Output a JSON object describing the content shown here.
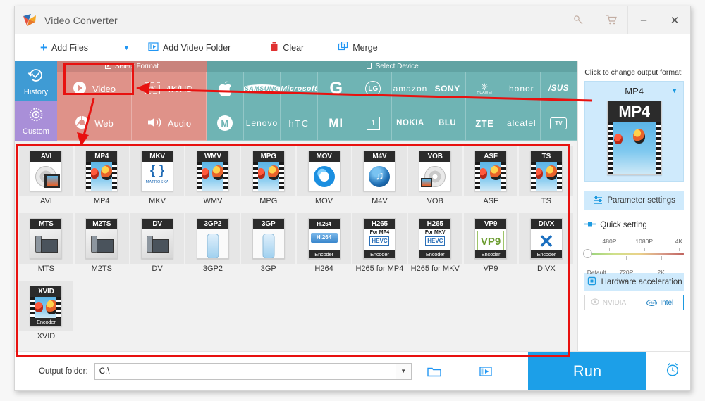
{
  "window": {
    "title": "Video Converter",
    "logo_icon": "app-logo-icon",
    "key_icon": "key-icon",
    "cart_icon": "cart-icon",
    "minimize": "–",
    "close": "✕"
  },
  "toolbar": {
    "add_files": "Add Files",
    "add_files_caret": "▼",
    "add_video_folder": "Add Video Folder",
    "clear": "Clear",
    "merge": "Merge",
    "plus_icon": "plus-icon",
    "folder_icon": "add-video-folder-icon",
    "trash_icon": "trash-icon",
    "merge_icon": "merge-icon"
  },
  "sidebar": {
    "items": [
      {
        "label": "History",
        "icon": "history-icon",
        "color": "#3f9bd4"
      },
      {
        "label": "Custom",
        "icon": "gear-icon",
        "color": "#a98fd8"
      }
    ]
  },
  "select_format": {
    "header": "Select Format",
    "header_icon": "format-icon",
    "tiles": [
      {
        "label": "Video",
        "icon": "play-circle-icon",
        "selected": true
      },
      {
        "label": "4K/HD",
        "icon": "hd-icon",
        "selected": false
      },
      {
        "label": "Web",
        "icon": "chrome-icon",
        "selected": false
      },
      {
        "label": "Audio",
        "icon": "speaker-icon",
        "selected": false
      }
    ]
  },
  "select_device": {
    "header": "Select Device",
    "header_icon": "device-icon",
    "tiles": [
      {
        "label": "Apple",
        "glyph": "",
        "style": "glyph"
      },
      {
        "label": "SAMSUNG",
        "glyph": "SAMSUNG",
        "style": "wordmark"
      },
      {
        "label": "Microsoft",
        "glyph": "Microsoft",
        "style": "wordmark"
      },
      {
        "label": "Google",
        "glyph": "G",
        "style": "big"
      },
      {
        "label": "LG",
        "glyph": "LG",
        "style": "round"
      },
      {
        "label": "amazon",
        "glyph": "amazon",
        "style": "thin"
      },
      {
        "label": "SONY",
        "glyph": "SONY",
        "style": "wordmark"
      },
      {
        "label": "HUAWEI",
        "glyph": "HUAWEI",
        "style": "huawei"
      },
      {
        "label": "honor",
        "glyph": "honor",
        "style": "thin"
      },
      {
        "label": "ASUS",
        "glyph": "/SUS",
        "style": "wordmark"
      },
      {
        "label": "Motorola",
        "glyph": "M",
        "style": "round"
      },
      {
        "label": "Lenovo",
        "glyph": "Lenovo",
        "style": "thin"
      },
      {
        "label": "HTC",
        "glyph": "hTC",
        "style": "thin"
      },
      {
        "label": "MI",
        "glyph": "MI",
        "style": "wordmark"
      },
      {
        "label": "OnePlus",
        "glyph": "1",
        "style": "boxed"
      },
      {
        "label": "NOKIA",
        "glyph": "NOKIA",
        "style": "wordmark"
      },
      {
        "label": "BLU",
        "glyph": "BLU",
        "style": "wordmark"
      },
      {
        "label": "ZTE",
        "glyph": "ZTE",
        "style": "wordmark"
      },
      {
        "label": "alcatel",
        "glyph": "alcatel",
        "style": "thin"
      },
      {
        "label": "TV",
        "glyph": "TV",
        "style": "tv"
      }
    ]
  },
  "formats": [
    {
      "label": "AVI",
      "badge": "AVI",
      "sub": "",
      "bottom": "",
      "art": "disc-film"
    },
    {
      "label": "MP4",
      "badge": "MP4",
      "sub": "",
      "bottom": "",
      "art": "balloon"
    },
    {
      "label": "MKV",
      "badge": "MKV",
      "sub": "",
      "bottom": "",
      "art": "matroska"
    },
    {
      "label": "WMV",
      "badge": "WMV",
      "sub": "",
      "bottom": "",
      "art": "balloon"
    },
    {
      "label": "MPG",
      "badge": "MPG",
      "sub": "",
      "bottom": "",
      "art": "balloon"
    },
    {
      "label": "MOV",
      "badge": "MOV",
      "sub": "",
      "bottom": "",
      "art": "quicktime"
    },
    {
      "label": "M4V",
      "badge": "M4V",
      "sub": "",
      "bottom": "",
      "art": "itunes"
    },
    {
      "label": "VOB",
      "badge": "VOB",
      "sub": "",
      "bottom": "",
      "art": "disc"
    },
    {
      "label": "ASF",
      "badge": "ASF",
      "sub": "",
      "bottom": "",
      "art": "balloon"
    },
    {
      "label": "TS",
      "badge": "TS",
      "sub": "",
      "bottom": "",
      "art": "balloon"
    },
    {
      "label": "MTS",
      "badge": "MTS",
      "sub": "",
      "bottom": "",
      "art": "camcorder"
    },
    {
      "label": "M2TS",
      "badge": "M2TS",
      "sub": "",
      "bottom": "",
      "art": "camcorder"
    },
    {
      "label": "DV",
      "badge": "DV",
      "sub": "",
      "bottom": "",
      "art": "camcorder"
    },
    {
      "label": "3GP2",
      "badge": "3GP2",
      "sub": "",
      "bottom": "",
      "art": "phone"
    },
    {
      "label": "3GP",
      "badge": "3GP",
      "sub": "",
      "bottom": "",
      "art": "phone"
    },
    {
      "label": "H264",
      "badge": "H.264",
      "sub": "",
      "bottom": "Encoder",
      "art": "h264"
    },
    {
      "label": "H265 for MP4",
      "badge": "H265",
      "sub": "For MP4",
      "bottom": "Encoder",
      "art": "hevc"
    },
    {
      "label": "H265 for MKV",
      "badge": "H265",
      "sub": "For MKV",
      "bottom": "Encoder",
      "art": "hevc"
    },
    {
      "label": "VP9",
      "badge": "VP9",
      "sub": "",
      "bottom": "Encoder",
      "art": "vp9"
    },
    {
      "label": "DIVX",
      "badge": "DIVX",
      "sub": "",
      "bottom": "Encoder",
      "art": "divx"
    },
    {
      "label": "XVID",
      "badge": "XVID",
      "sub": "",
      "bottom": "Encoder",
      "art": "balloon"
    }
  ],
  "right_panel": {
    "hint": "Click to change output format:",
    "output_format": "MP4",
    "output_caret": "▼",
    "output_badge": "MP4",
    "parameter_settings": "Parameter settings",
    "parameter_icon": "sliders-icon",
    "quick_setting": "Quick setting",
    "quick_setting_icon": "quick-setting-icon",
    "slider": {
      "top_labels": [
        "480P",
        "1080P",
        "4K"
      ],
      "bottom_labels": [
        "Default",
        "720P",
        "2K"
      ],
      "value": "Default"
    },
    "hardware_acceleration": "Hardware acceleration",
    "hardware_icon": "chip-icon",
    "gpus": [
      {
        "label": "NVIDIA",
        "enabled": false
      },
      {
        "label": "Intel",
        "enabled": true
      }
    ]
  },
  "bottom": {
    "output_folder_label": "Output folder:",
    "output_folder_value": "C:\\",
    "dropdown_caret": "▼",
    "browse_icon": "folder-icon",
    "media_icon": "media-library-icon",
    "run_label": "Run",
    "alarm_icon": "alarm-clock-icon"
  },
  "annotations": {
    "highlight_color": "#e8110f",
    "boxes": [
      "video-tile-highlight",
      "format-grid-highlight"
    ],
    "arrows": [
      "arrow-to-video-tile",
      "arrow-from-video-to-grid"
    ]
  }
}
